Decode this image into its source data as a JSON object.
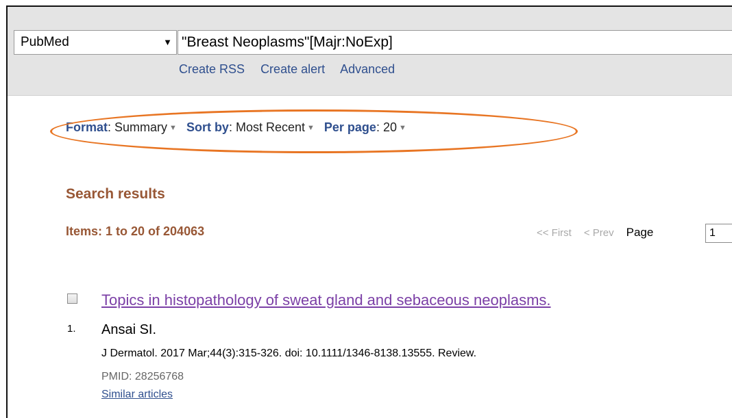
{
  "search": {
    "database": "PubMed",
    "query": "\"Breast Neoplasms\"[Majr:NoExp]",
    "links": [
      "Create RSS",
      "Create alert",
      "Advanced"
    ]
  },
  "display_settings": {
    "format_label": "Format",
    "format_value": "Summary",
    "sort_label": "Sort by",
    "sort_value": "Most Recent",
    "perpage_label": "Per page",
    "perpage_value": "20"
  },
  "results": {
    "title": "Search results",
    "count_text": "Items: 1 to 20 of 204063",
    "pager": {
      "first": "<< First",
      "prev": "< Prev",
      "page_label": "Page",
      "page_value": "1"
    }
  },
  "articles": [
    {
      "rank": "1.",
      "title": "Topics in histopathology of sweat gland and sebaceous neoplasms.",
      "authors": "Ansai SI.",
      "citation": "J Dermatol. 2017 Mar;44(3):315-326. doi: 10.1111/1346-8138.13555. Review.",
      "pmid": "PMID: 28256768",
      "similar": "Similar articles"
    }
  ],
  "colors": {
    "link_blue": "#2f4f8e",
    "heading_brown": "#985735",
    "visited_purple": "#7b3fa6",
    "highlight_orange": "#e87523",
    "searchbar_gray": "#e4e4e4"
  }
}
